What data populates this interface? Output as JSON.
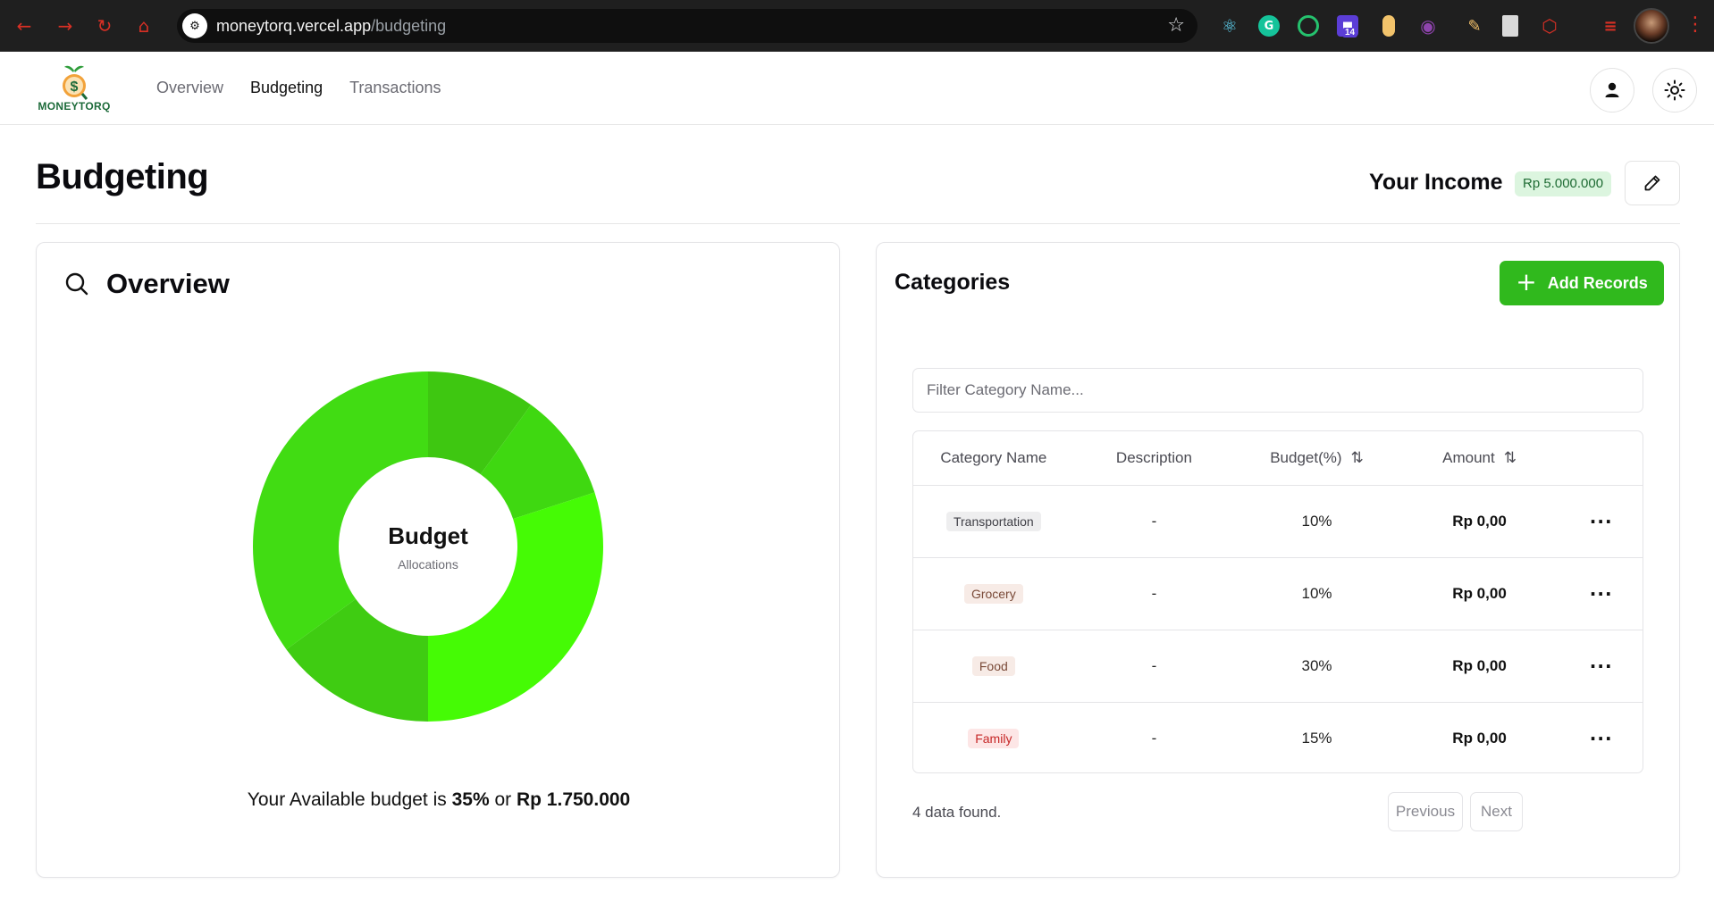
{
  "browser": {
    "url_host": "moneytorq.vercel.app",
    "url_path": "/budgeting",
    "extension_badge": "14"
  },
  "app": {
    "logo_text": "MONEYTORQ",
    "nav": [
      {
        "label": "Overview",
        "active": false
      },
      {
        "label": "Budgeting",
        "active": true
      },
      {
        "label": "Transactions",
        "active": false
      }
    ]
  },
  "page": {
    "title": "Budgeting",
    "income_label": "Your Income",
    "income_value": "Rp 5.000.000"
  },
  "overview": {
    "title": "Overview",
    "center_title": "Budget",
    "center_subtitle": "Allocations",
    "available_prefix": "Your Available budget is ",
    "available_percent": "35%",
    "available_mid": " or ",
    "available_amount": "Rp 1.750.000"
  },
  "chart_data": {
    "type": "pie",
    "categories": [
      "Transportation",
      "Grocery",
      "Food",
      "Family",
      "Available"
    ],
    "values": [
      10,
      10,
      30,
      15,
      35
    ],
    "colors": [
      "#3ec711",
      "#3fd811",
      "#45fb05",
      "#3fcc12",
      "#41dc13"
    ]
  },
  "categories": {
    "title": "Categories",
    "add_button": "Add Records",
    "filter_placeholder": "Filter Category Name...",
    "columns": [
      "Category Name",
      "Description",
      "Budget(%)",
      "Amount"
    ],
    "rows": [
      {
        "name": "Transportation",
        "description": "-",
        "budget": "10%",
        "amount": "Rp 0,00",
        "tag_bg": "#eeeeef",
        "tag_fg": "#3f3f46"
      },
      {
        "name": "Grocery",
        "description": "-",
        "budget": "10%",
        "amount": "Rp 0,00",
        "tag_bg": "#f7ebe6",
        "tag_fg": "#7a4a38"
      },
      {
        "name": "Food",
        "description": "-",
        "budget": "30%",
        "amount": "Rp 0,00",
        "tag_bg": "#f7ebe6",
        "tag_fg": "#7a4a38"
      },
      {
        "name": "Family",
        "description": "-",
        "budget": "15%",
        "amount": "Rp 0,00",
        "tag_bg": "#fde6e6",
        "tag_fg": "#c62828"
      }
    ],
    "found_text": "4 data found.",
    "prev_label": "Previous",
    "next_label": "Next"
  },
  "colors": {
    "accent_green": "#30b91d",
    "income_badge_bg": "#dcf5df"
  }
}
